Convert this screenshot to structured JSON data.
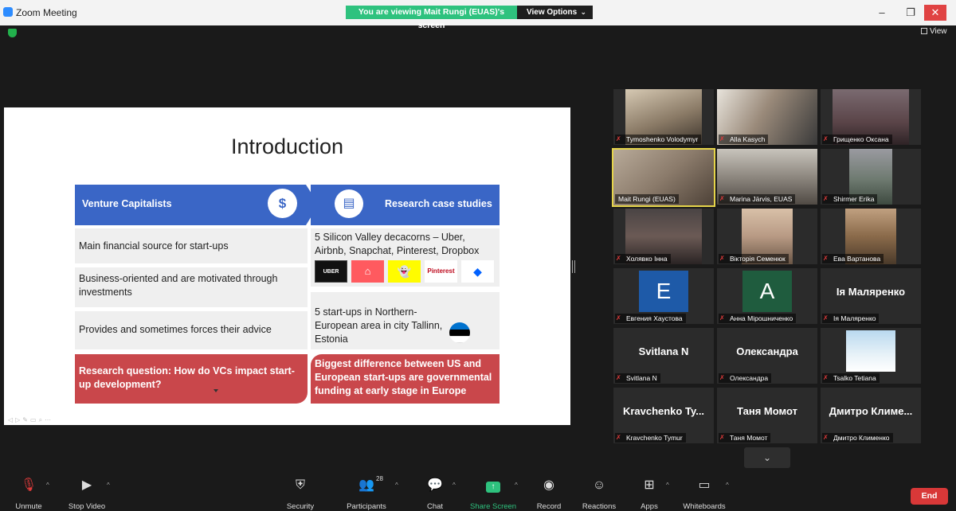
{
  "window": {
    "title": "Zoom Meeting"
  },
  "banner": {
    "text": "You are viewing Mait Rungi (EUAS)'s screen",
    "view_options": "View Options"
  },
  "view_button": "View",
  "slide": {
    "title": "Introduction",
    "left_header": "Venture Capitalists",
    "right_header": "Research case studies",
    "left_items": [
      "Main financial source for start-ups",
      "Business-oriented and are motivated through investments",
      "Provides and sometimes forces their advice"
    ],
    "right_items": [
      "5 Silicon Valley decacorns – Uber, Airbnb, Snapchat, Pinterest, Dropbox",
      "5 start-ups in Northern-European area in city Tallinn, Estonia"
    ],
    "left_red": "Research question: How do VCs impact start-up development?",
    "right_red": "Biggest difference between US and European start-ups are governmental funding at early stage in Europe",
    "logos": [
      "UBER",
      "airbnb",
      "Snapchat",
      "Pinterest",
      "Dropbox"
    ],
    "logo_texts": {
      "uber": "UBER",
      "pinterest": "Pinterest"
    }
  },
  "participants": [
    {
      "name": "Tymoshenko Volodymyr"
    },
    {
      "name": "Alla Kasych"
    },
    {
      "name": "Грищенко Оксана"
    },
    {
      "name": "Mait Rungi (EUAS)"
    },
    {
      "name": "Marina Järvis, EUAS"
    },
    {
      "name": "Shirmer Erika"
    },
    {
      "name": "Холявко Інна"
    },
    {
      "name": "Вікторія Семенюк"
    },
    {
      "name": "Ева Вартанова"
    },
    {
      "name": "Евгения Хаустова",
      "initial": "E"
    },
    {
      "name": "Анна Мірошниченко",
      "initial": "A"
    },
    {
      "name": "Ія Маляренко",
      "display": "Ія Маляренко"
    },
    {
      "name": "Svitlana N",
      "display": "Svitlana N"
    },
    {
      "name": "Олександра",
      "display": "Олександра"
    },
    {
      "name": "Tsalko Tetiana"
    },
    {
      "name": "Kravchenko Tymur",
      "display": "Kravchenko Ty..."
    },
    {
      "name": "Таня Момот",
      "display": "Таня Момот"
    },
    {
      "name": "Дмитро Клименко",
      "display": "Дмитро Климе..."
    }
  ],
  "toolbar": {
    "unmute": "Unmute",
    "stop_video": "Stop Video",
    "security": "Security",
    "participants": "Participants",
    "participants_count": "28",
    "chat": "Chat",
    "share_screen": "Share Screen",
    "record": "Record",
    "reactions": "Reactions",
    "apps": "Apps",
    "whiteboards": "Whiteboards",
    "end": "End"
  },
  "colors": {
    "accent_green": "#2ec27e",
    "slide_blue": "#3a66c6",
    "slide_red": "#c9474b",
    "end_red": "#d83838"
  }
}
